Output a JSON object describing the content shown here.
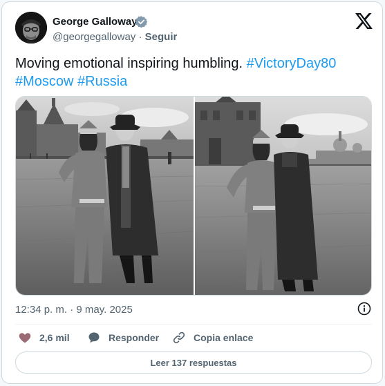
{
  "author": {
    "name": "George Galloway",
    "handle": "@georgegalloway",
    "separator": "·",
    "follow_label": "Seguir"
  },
  "tweet": {
    "text": "Moving emotional inspiring humbling.",
    "hashtags": [
      "#VictoryDay80",
      "#Moscow",
      "#Russia"
    ]
  },
  "timestamp": "12:34 p. m. · 9 may. 2025",
  "actions": {
    "likes": "2,6 mil",
    "reply_label": "Responder",
    "copy_label": "Copia enlace"
  },
  "read_replies_label": "Leer 137 respuestas",
  "colors": {
    "accent": "#1d9bf0",
    "secondary_text": "#536471",
    "like_heart": "#9b6b75",
    "border": "#cfd9de"
  },
  "icons": [
    "verified-badge-icon",
    "x-logo-icon",
    "info-icon",
    "heart-icon",
    "reply-bubble-icon",
    "link-icon"
  ]
}
